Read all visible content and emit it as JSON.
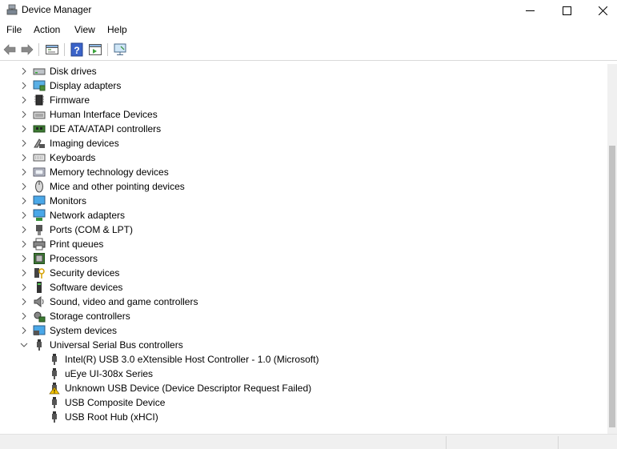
{
  "window": {
    "title": "Device Manager",
    "minimize_icon": "minimize-icon",
    "maximize_icon": "maximize-icon",
    "close_icon": "close-icon"
  },
  "menu": [
    "File",
    "Action",
    "View",
    "Help"
  ],
  "toolbar": [
    "back-icon",
    "forward-icon",
    "properties-icon",
    "help-icon",
    "view-icon",
    "monitor-icon"
  ],
  "tree": {
    "categories": [
      {
        "label": "Disk drives",
        "icon": "disk-drive-icon"
      },
      {
        "label": "Display adapters",
        "icon": "display-adapter-icon"
      },
      {
        "label": "Firmware",
        "icon": "firmware-icon"
      },
      {
        "label": "Human Interface Devices",
        "icon": "hid-icon"
      },
      {
        "label": "IDE ATA/ATAPI controllers",
        "icon": "ide-controller-icon"
      },
      {
        "label": "Imaging devices",
        "icon": "camera-icon"
      },
      {
        "label": "Keyboards",
        "icon": "keyboard-icon"
      },
      {
        "label": "Memory technology devices",
        "icon": "memory-icon"
      },
      {
        "label": "Mice and other pointing devices",
        "icon": "mouse-icon"
      },
      {
        "label": "Monitors",
        "icon": "monitor-icon"
      },
      {
        "label": "Network adapters",
        "icon": "network-icon"
      },
      {
        "label": "Ports (COM & LPT)",
        "icon": "port-icon"
      },
      {
        "label": "Print queues",
        "icon": "printer-icon"
      },
      {
        "label": "Processors",
        "icon": "processor-icon"
      },
      {
        "label": "Security devices",
        "icon": "security-icon"
      },
      {
        "label": "Software devices",
        "icon": "software-icon"
      },
      {
        "label": "Sound, video and game controllers",
        "icon": "speaker-icon"
      },
      {
        "label": "Storage controllers",
        "icon": "storage-icon"
      },
      {
        "label": "System devices",
        "icon": "system-icon"
      },
      {
        "label": "Universal Serial Bus controllers",
        "icon": "usb-icon",
        "expanded": true
      }
    ],
    "usb_children": [
      {
        "label": "Intel(R) USB 3.0 eXtensible Host Controller - 1.0 (Microsoft)",
        "icon": "usb-icon"
      },
      {
        "label": "uEye UI-308x Series",
        "icon": "usb-icon"
      },
      {
        "label": "Unknown USB Device (Device Descriptor Request Failed)",
        "icon": "usb-warning-icon"
      },
      {
        "label": "USB Composite Device",
        "icon": "usb-icon"
      },
      {
        "label": "USB Root Hub (xHCI)",
        "icon": "usb-icon"
      }
    ]
  },
  "colors": {
    "warning": "#f5c400",
    "selection": "#cce8ff"
  }
}
